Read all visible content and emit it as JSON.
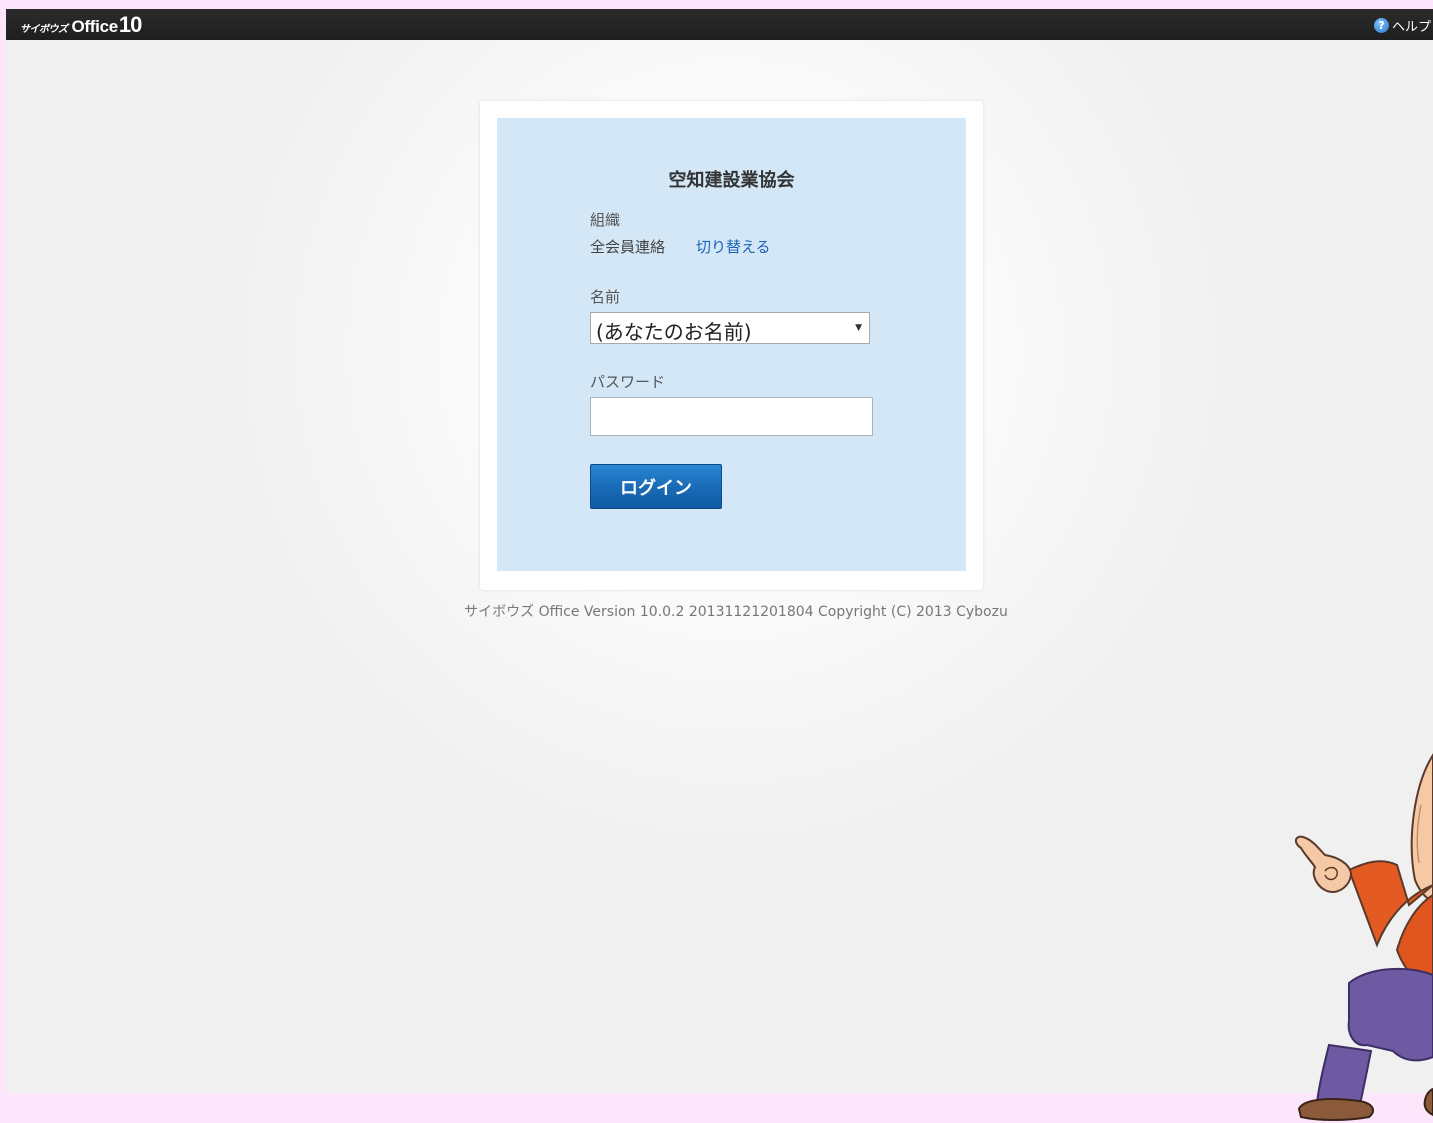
{
  "header": {
    "logo_kana": "サイボウズ",
    "logo_office": "Office",
    "logo_version": "10",
    "help_icon_glyph": "?",
    "help_label": "ヘルプ"
  },
  "login": {
    "org_title": "空知建設業協会",
    "org_label": "組織",
    "org_name": "全会員連絡",
    "switch_link": "切り替える",
    "name_label": "名前",
    "name_selected": "(あなたのお名前)",
    "password_label": "パスワード",
    "password_value": "",
    "login_button": "ログイン"
  },
  "footer": {
    "version_text": "サイボウズ Office Version 10.0.2 20131121201804 Copyright (C) 2013 Cybozu"
  },
  "colors": {
    "topbar": "#262626",
    "panel": "#d3e7f6",
    "link": "#1e63b8",
    "button": "#1a6cb8",
    "page_bottom": "#fce6fb"
  },
  "icons": {
    "help": "help-question-icon",
    "select_arrow": "triangle-down-icon",
    "mascot": "mascot-character-illustration"
  }
}
